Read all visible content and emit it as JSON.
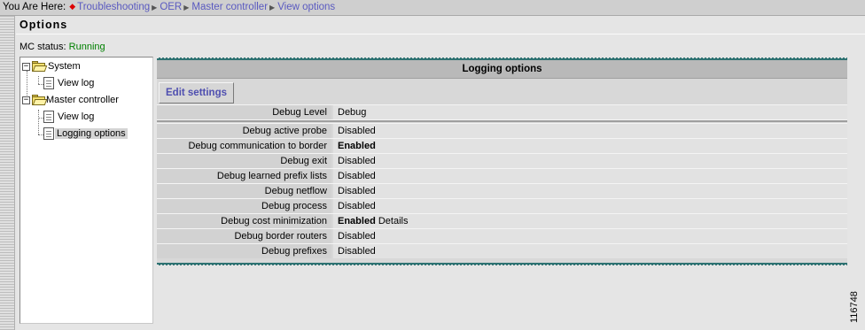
{
  "breadcrumb": {
    "prefix": "You Are Here:",
    "items": [
      "Troubleshooting",
      "OER",
      "Master controller",
      "View options"
    ]
  },
  "page_title": "Options",
  "mc_status": {
    "label": "MC status:",
    "value": "Running"
  },
  "tree": {
    "system": "System",
    "system_view_log": "View log",
    "master_controller": "Master controller",
    "mc_view_log": "View log",
    "mc_logging_options": "Logging options"
  },
  "panel": {
    "title": "Logging options",
    "edit_button": "Edit settings",
    "debug_level": {
      "label": "Debug Level",
      "value": "Debug"
    },
    "rows": [
      {
        "label": "Debug active probe",
        "value": "Disabled"
      },
      {
        "label": "Debug communication to border routers",
        "value": "Enabled"
      },
      {
        "label": "Debug exit",
        "value": "Disabled"
      },
      {
        "label": "Debug learned prefix lists",
        "value": "Disabled"
      },
      {
        "label": "Debug netflow",
        "value": "Disabled"
      },
      {
        "label": "Debug process",
        "value": "Disabled"
      },
      {
        "label": "Debug cost minimization",
        "value": "Enabled",
        "extra": "Details"
      },
      {
        "label": "Debug border routers",
        "value": "Disabled"
      },
      {
        "label": "Debug prefixes",
        "value": "Disabled"
      }
    ]
  },
  "figure_id": "116748",
  "colors": {
    "status_running": "#008000",
    "link": "#5a5ac0",
    "panel_border": "#2e7272"
  }
}
